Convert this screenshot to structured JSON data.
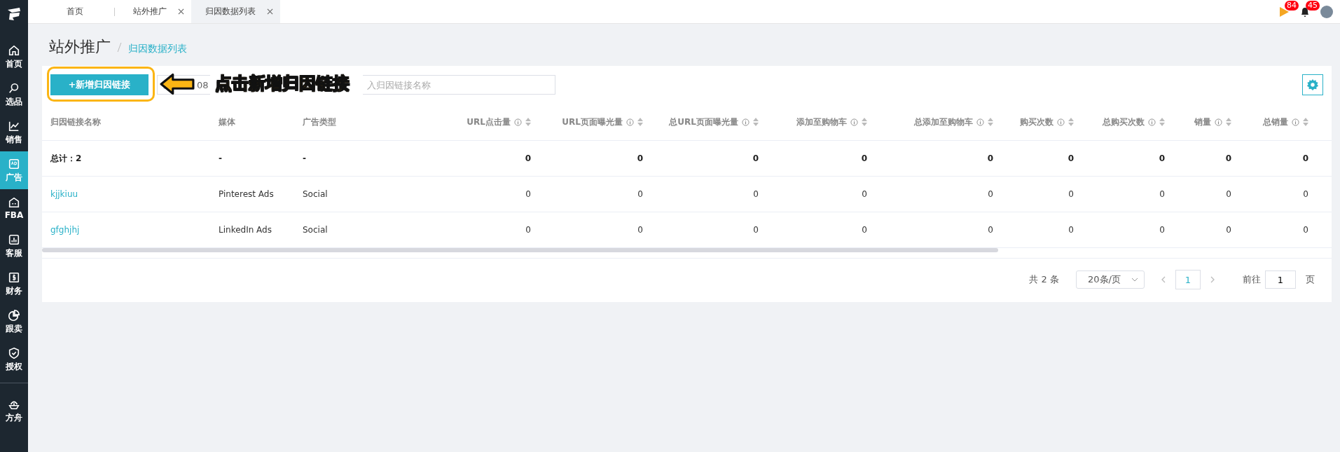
{
  "sidebar": {
    "items": [
      {
        "label": "首页",
        "kind": "home",
        "selected": false
      },
      {
        "label": "选品",
        "kind": "search",
        "selected": false
      },
      {
        "label": "销售",
        "kind": "chart",
        "selected": false
      },
      {
        "label": "广告",
        "kind": "ad",
        "selected": true
      },
      {
        "label": "FBA",
        "kind": "house",
        "selected": false
      },
      {
        "label": "客服",
        "kind": "bars",
        "selected": false
      },
      {
        "label": "财务",
        "kind": "dollar",
        "selected": false
      },
      {
        "label": "跟卖",
        "kind": "pie",
        "selected": false
      },
      {
        "label": "授权",
        "kind": "shield",
        "selected": false
      },
      {
        "label": "方舟",
        "kind": "ark",
        "selected": false
      }
    ]
  },
  "tabs": [
    {
      "label": "首页",
      "closable": false,
      "selected": false
    },
    {
      "label": "站外推广",
      "closable": true,
      "selected": false
    },
    {
      "label": "归因数据列表",
      "closable": true,
      "selected": true
    }
  ],
  "header_icons": [
    {
      "kind": "flag",
      "badge": "84"
    },
    {
      "kind": "bell",
      "badge": "45"
    },
    {
      "kind": "avatar"
    }
  ],
  "breadcrumb": {
    "title": "站外推广",
    "current": "归因数据列表"
  },
  "toolbar": {
    "add_button": "+新增归因链接",
    "date_field": {
      "value": "08"
    },
    "search": {
      "placeholder": "入归因链接名称"
    }
  },
  "annotation": {
    "text": "点击新增归因链接"
  },
  "table": {
    "columns": [
      {
        "label": "归因链接名称",
        "kind": "link"
      },
      {
        "label": "媒体",
        "kind": "text"
      },
      {
        "label": "广告类型",
        "kind": "text"
      },
      {
        "label": "URL点击量",
        "kind": "number"
      },
      {
        "label": "URL页面曝光量",
        "kind": "number"
      },
      {
        "label": "总URL页面曝光量",
        "kind": "number"
      },
      {
        "label": "添加至购物车",
        "kind": "number"
      },
      {
        "label": "总添加至购物车",
        "kind": "number"
      },
      {
        "label": "购买次数",
        "kind": "number"
      },
      {
        "label": "总购买次数",
        "kind": "number"
      },
      {
        "label": "销量",
        "kind": "number"
      },
      {
        "label": "总销量",
        "kind": "number"
      }
    ],
    "total_row": [
      "总计：2",
      "-",
      "-",
      "0",
      "0",
      "0",
      "0",
      "0",
      "0",
      "0",
      "0",
      "0"
    ],
    "rows": [
      {
        "cells": [
          "kjjkiuu",
          "Pinterest Ads",
          "Social",
          "0",
          "0",
          "0",
          "0",
          "0",
          "0",
          "0",
          "0",
          "0"
        ]
      },
      {
        "cells": [
          "gfghjhj",
          "LinkedIn Ads",
          "Social",
          "0",
          "0",
          "0",
          "0",
          "0",
          "0",
          "0",
          "0",
          "0"
        ]
      }
    ]
  },
  "pagination": {
    "total": "共 2 条",
    "page_size": "20条/页",
    "pages": [
      {
        "label": "1",
        "selected": true
      }
    ],
    "goto_label": "前往",
    "goto_value": "1",
    "goto_suffix": "页"
  }
}
